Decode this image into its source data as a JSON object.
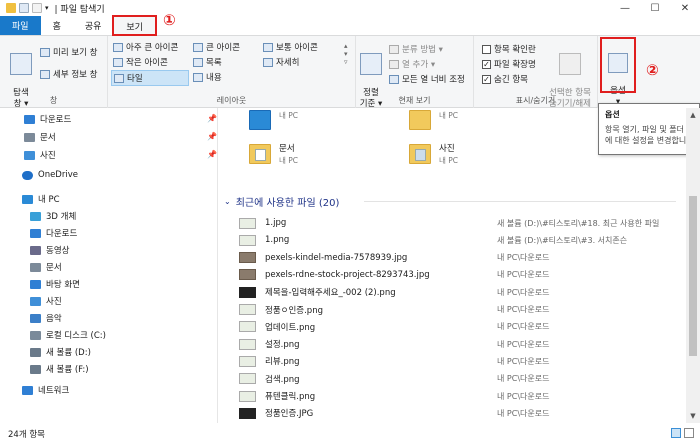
{
  "titlebar": {
    "title": "| 파일 탐색기",
    "minimize": "—",
    "maximize": "☐",
    "close": "✕"
  },
  "tabs": [
    {
      "label": "파일"
    },
    {
      "label": "홈"
    },
    {
      "label": "공유"
    },
    {
      "label": "보기"
    }
  ],
  "annotations": {
    "one": "①",
    "two": "②"
  },
  "ribbon": {
    "pane": {
      "nav_pane": "탐색\n창 ▾",
      "preview": "미리 보기 창",
      "details": "세부 정보 창",
      "group": "창"
    },
    "layout": {
      "items": [
        "아주 큰 아이콘",
        "큰 아이콘",
        "보통 아이콘",
        "작은 아이콘",
        "목록",
        "자세히",
        "타일",
        "내용"
      ],
      "group": "레이아웃"
    },
    "current_view": {
      "sort": "정렬\n기준 ▾",
      "group_by": "분류 방법 ▾",
      "add_column": "열 추가 ▾",
      "fit_columns": "모든 열 너비 조정",
      "group": "현재 보기"
    },
    "show_hide": {
      "item_checkboxes": "항목 확인란",
      "file_extensions": "파일 확장명",
      "hidden_items": "숨긴 항목",
      "hide_selected": "선택한 항목\n숨기기/해제",
      "group": "표시/숨기기"
    },
    "options": {
      "label": "옵션\n▾"
    }
  },
  "tooltip": {
    "title": "옵션",
    "body1": "항목 열기, 파일 및 폴더",
    "body2": "에 대한 설정을 변경합니"
  },
  "nav": {
    "quick": [
      {
        "label": "다운로드",
        "color": "#2f7fd4"
      },
      {
        "label": "문서",
        "color": "#7c8a99"
      },
      {
        "label": "사진",
        "color": "#3f8fd8"
      }
    ],
    "onedrive": "OneDrive",
    "pc": "내 PC",
    "pc_items": [
      {
        "label": "3D 개체",
        "color": "#39a0d8"
      },
      {
        "label": "다운로드",
        "color": "#2f7fd4"
      },
      {
        "label": "동영상",
        "color": "#6a6a8a"
      },
      {
        "label": "문서",
        "color": "#7c8a99"
      },
      {
        "label": "바탕 화면",
        "color": "#2f7fd4"
      },
      {
        "label": "사진",
        "color": "#3f8fd8"
      },
      {
        "label": "음악",
        "color": "#3b7fc8"
      },
      {
        "label": "로컬 디스크 (C:)",
        "color": "#7a8a9a"
      },
      {
        "label": "새 볼륨 (D:)",
        "color": "#6a7a8a"
      },
      {
        "label": "새 볼륨 (F:)",
        "color": "#6a7a8a"
      }
    ],
    "network": "네트워크"
  },
  "folders": [
    {
      "name": "",
      "sub": "내 PC"
    },
    {
      "name": "",
      "sub": "내 PC"
    },
    {
      "name": "문서",
      "sub": "내 PC"
    },
    {
      "name": "사진",
      "sub": "내 PC"
    }
  ],
  "recent": {
    "header": "최근에 사용한 파일 (20)",
    "files": [
      {
        "name": "1.jpg",
        "loc": "새 볼륨 (D:)\\#티스토리\\#18. 최근 사용한 파일",
        "thumb": "light"
      },
      {
        "name": "1.png",
        "loc": "새 볼륨 (D:)\\#티스토리\\#3. 서치존슨",
        "thumb": "light"
      },
      {
        "name": "pexels-kindel-media-7578939.jpg",
        "loc": "내 PC\\다운로드",
        "thumb": "photo"
      },
      {
        "name": "pexels-rdne-stock-project-8293743.jpg",
        "loc": "내 PC\\다운로드",
        "thumb": "photo"
      },
      {
        "name": "제목을-입력해주세요_-002 (2).png",
        "loc": "내 PC\\다운로드",
        "thumb": "dark"
      },
      {
        "name": "정품ㅇ인증.png",
        "loc": "내 PC\\다운로드",
        "thumb": "light"
      },
      {
        "name": "업데이트.png",
        "loc": "내 PC\\다운로드",
        "thumb": "light"
      },
      {
        "name": "설정.png",
        "loc": "내 PC\\다운로드",
        "thumb": "light"
      },
      {
        "name": "리뷰.png",
        "loc": "내 PC\\다운로드",
        "thumb": "light"
      },
      {
        "name": "검색.png",
        "loc": "내 PC\\다운로드",
        "thumb": "light"
      },
      {
        "name": "퓨텐클릭.png",
        "loc": "내 PC\\다운로드",
        "thumb": "light"
      },
      {
        "name": "정품인증.JPG",
        "loc": "내 PC\\다운로드",
        "thumb": "dark"
      }
    ]
  },
  "status": {
    "count": "24개 항목"
  }
}
